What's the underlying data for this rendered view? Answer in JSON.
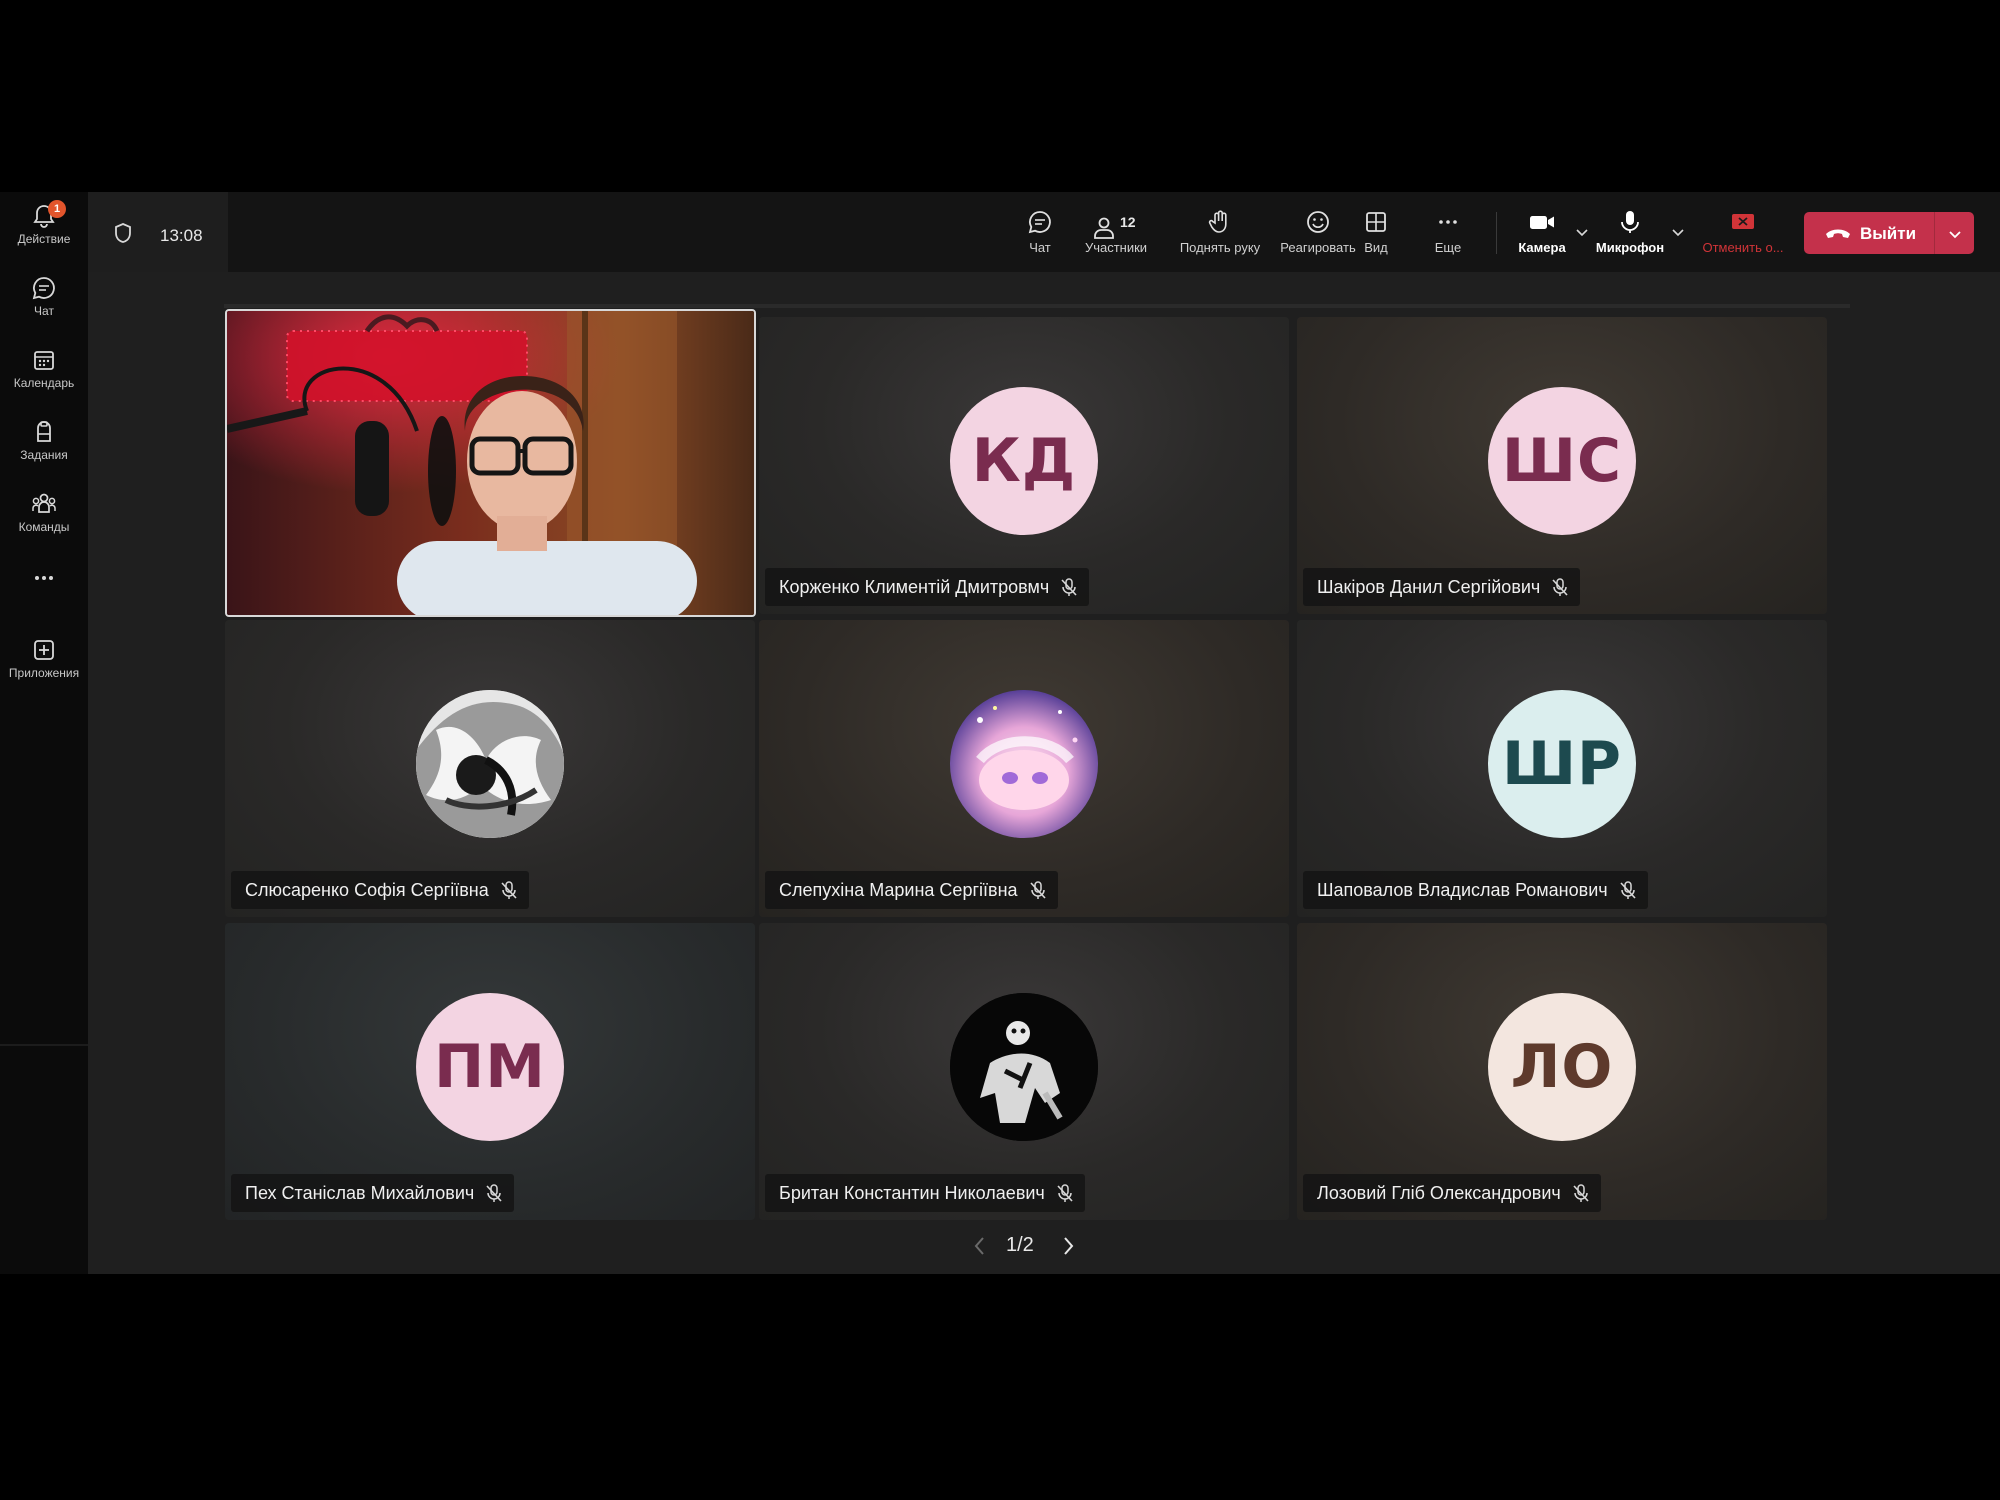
{
  "app_bar": {
    "items": [
      {
        "label": "Действие",
        "icon": "bell-icon",
        "badge": "1"
      },
      {
        "label": "Чат",
        "icon": "chat-icon"
      },
      {
        "label": "Календарь",
        "icon": "calendar-icon"
      },
      {
        "label": "Задания",
        "icon": "assignments-icon"
      },
      {
        "label": "Команды",
        "icon": "teams-icon"
      },
      {
        "label": "",
        "icon": "more-icon"
      },
      {
        "label": "Приложения",
        "icon": "add-apps-icon"
      }
    ]
  },
  "header": {
    "timer": "13:08",
    "toolbar": {
      "chat": "Чат",
      "participants": "Участники",
      "participants_count": "12",
      "raise_hand": "Поднять руку",
      "react": "Реагировать",
      "view": "Вид",
      "more": "Еще",
      "camera": "Камера",
      "microphone": "Микрофон",
      "share": "Отменить о...",
      "leave": "Выйти"
    }
  },
  "tiles": [
    {
      "name": "Корженко Климентій Дмитровмч",
      "initials": "КД",
      "avatar_color": "#f3d4e2"
    },
    {
      "name": "Шакіров Данил Сергійович",
      "initials": "ШС",
      "avatar_color": "#f3d4e2"
    },
    {
      "name": "Слюсаренко Софія Сергіївна",
      "initials": "",
      "avatar_type": "photo-bw-anime"
    },
    {
      "name": "Слепухіна Марина Сергіївна",
      "initials": "",
      "avatar_type": "photo-pastel-anime"
    },
    {
      "name": "Шаповалов Владислав Романович",
      "initials": "ШР",
      "avatar_color": "#dbeeee"
    },
    {
      "name": "Пех Станіслав Михайлович",
      "initials": "ПМ",
      "avatar_color": "#f3d4e2"
    },
    {
      "name": "Британ Константин Николаевич",
      "initials": "",
      "avatar_type": "photo-dark-figure"
    },
    {
      "name": "Лозовий Гліб Олександрович",
      "initials": "ЛО",
      "avatar_color": "#f3e6df"
    }
  ],
  "pager": {
    "text": "1/2"
  },
  "colors": {
    "leave_button": "#c4314b",
    "badge": "#e2552c",
    "stop_share": "#d13438"
  }
}
